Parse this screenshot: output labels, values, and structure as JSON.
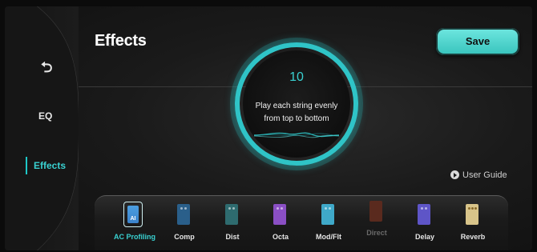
{
  "header": {
    "title": "Effects",
    "save_label": "Save"
  },
  "sidebar": {
    "back_glyph": "⮌",
    "items": [
      {
        "label": "EQ"
      },
      {
        "label": "Effects"
      }
    ]
  },
  "dial": {
    "count": "10",
    "instruction": "Play each string evenly from top to bottom"
  },
  "guide": {
    "label": "User Guide"
  },
  "accent": "#2fc4c7",
  "pedals": [
    {
      "label": "AC Profiling",
      "color": "#3b83cc",
      "state": "active"
    },
    {
      "label": "Comp",
      "color": "#2a5f8a",
      "state": "normal"
    },
    {
      "label": "Dist",
      "color": "#2e6b6f",
      "state": "normal"
    },
    {
      "label": "Octa",
      "color": "#8a4fc4",
      "state": "normal"
    },
    {
      "label": "Mod/Flt",
      "color": "#3fa9c9",
      "state": "normal"
    },
    {
      "label": "Direct",
      "color": "#5a2a1e",
      "state": "disabled"
    },
    {
      "label": "Delay",
      "color": "#5e55c7",
      "state": "normal"
    },
    {
      "label": "Reverb",
      "color": "#d8c48a",
      "state": "normal"
    }
  ]
}
